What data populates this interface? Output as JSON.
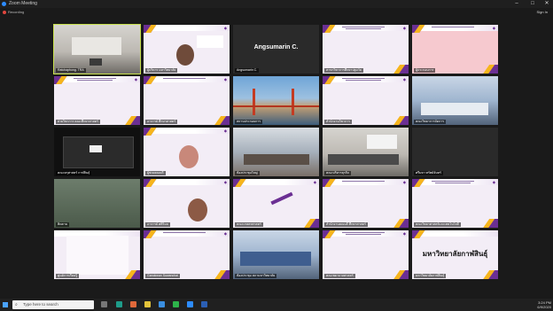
{
  "window": {
    "title": "Zoom Meeting",
    "minimize": "–",
    "maximize": "□",
    "close": "✕"
  },
  "toolbar": {
    "recording": "Recording",
    "sign_in": "Sign In"
  },
  "tiles": [
    {
      "label": "Ratchaphong. TRA",
      "kind": "room"
    },
    {
      "label": "ผู้บริหาร มหาวิทยาลัย",
      "kind": "slide-face"
    },
    {
      "label": "Angsumarin C.",
      "kind": "name",
      "name": "Angsumarin C."
    },
    {
      "label": "สาขาวิชาการศึกษาปฐมวัย",
      "kind": "slide"
    },
    {
      "label": "ผู้ประกอบการ",
      "kind": "slide-pink"
    },
    {
      "label": "ฝ่ายวิชาการ คณะศึกษาศาสตร์",
      "kind": "slide"
    },
    {
      "label": "อาจารย์ ศึกษาศาสตร์",
      "kind": "slide"
    },
    {
      "label": "สถานประกอบการ",
      "kind": "bridge"
    },
    {
      "label": "สำนักงานวิชาการ",
      "kind": "slide"
    },
    {
      "label": "คณะวิทยาการจัดการ",
      "kind": "meeting"
    },
    {
      "label": "คณะครุศาสตร์ กาฬสินธุ์",
      "kind": "screen"
    },
    {
      "label": "ผู้ช่วยคณบดี",
      "kind": "slide-person"
    },
    {
      "label": "ห้องประชุมใหญ่",
      "kind": "meeting"
    },
    {
      "label": "คณะบริหารธุรกิจ",
      "kind": "meeting"
    },
    {
      "label": "ศรีมหา ทรัพย์จันทร์",
      "kind": "dark"
    },
    {
      "label": "ติดตาม",
      "kind": "green"
    },
    {
      "label": "อาจารย์ ศศิวิมล",
      "kind": "slide-person"
    },
    {
      "label": "คณะเกษตรศาสตร์",
      "kind": "slide-draw"
    },
    {
      "label": "สำนักงานคณบดี ศึกษาศาสตร์",
      "kind": "slide"
    },
    {
      "label": "คณะวิทยาศาสตร์และเทคโนโลยี",
      "kind": "slide"
    },
    {
      "label": "ศูนย์การเรียนรู้",
      "kind": "slide"
    },
    {
      "label": "Ganokwan Suwanchai",
      "kind": "slide"
    },
    {
      "label": "ห้องประชุม สภามหาวิทยาลัย",
      "kind": "meeting"
    },
    {
      "label": "คณะพยาบาลศาสตร์",
      "kind": "slide"
    },
    {
      "label": "มหาวิทยาลัยกาฬสินธุ์",
      "kind": "univ",
      "name": "มหาวิทยาลัยกาฬสินธุ์"
    }
  ],
  "taskbar": {
    "search_placeholder": "Type here to search",
    "time": "3:24 PM",
    "date": "6/9/2020"
  }
}
